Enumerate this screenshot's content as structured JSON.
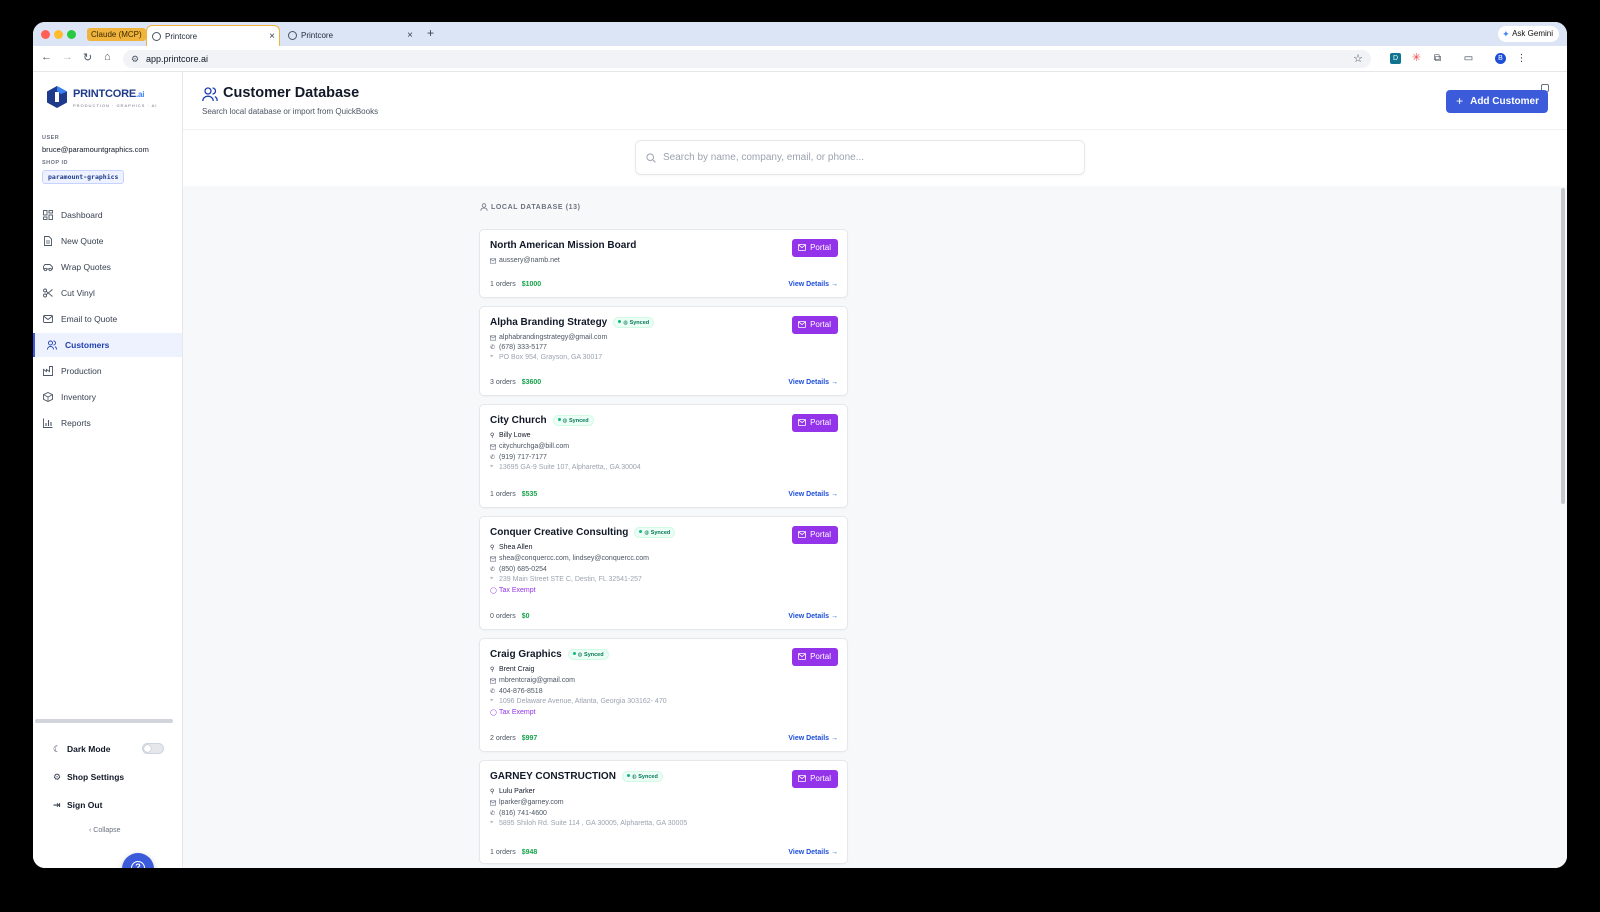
{
  "browser": {
    "group_chip": "Claude (MCP)",
    "tabs": [
      {
        "title": "Printcore",
        "active": true
      },
      {
        "title": "Printcore",
        "active": false
      }
    ],
    "url": "app.printcore.ai",
    "ask_gemini": "Ask Gemini",
    "profile_initial": "B"
  },
  "sidebar": {
    "logo_name": "PRINTCORE",
    "logo_suffix": ".ai",
    "logo_tagline": "PRODUCTION · GRAPHICS · AI",
    "user_label": "USER",
    "user_email": "bruce@paramountgraphics.com",
    "shop_label": "SHOP ID",
    "shop_id": "paramount-graphics",
    "nav": [
      {
        "label": "Dashboard",
        "icon": "grid-icon"
      },
      {
        "label": "New Quote",
        "icon": "document-icon"
      },
      {
        "label": "Wrap Quotes",
        "icon": "car-icon"
      },
      {
        "label": "Cut Vinyl",
        "icon": "scissors-icon"
      },
      {
        "label": "Email to Quote",
        "icon": "mail-icon"
      },
      {
        "label": "Customers",
        "icon": "users-icon",
        "active": true
      },
      {
        "label": "Production",
        "icon": "factory-icon"
      },
      {
        "label": "Inventory",
        "icon": "box-icon"
      },
      {
        "label": "Reports",
        "icon": "bar-chart-icon"
      }
    ],
    "dark_mode": "Dark Mode",
    "shop_settings": "Shop Settings",
    "sign_out": "Sign Out",
    "collapse": "Collapse"
  },
  "header": {
    "title": "Customer Database",
    "subtitle": "Search local database or import from QuickBooks",
    "add_button": "Add Customer"
  },
  "search": {
    "placeholder": "Search by name, company, email, or phone...",
    "value": ""
  },
  "section": {
    "label": "LOCAL DATABASE (13)"
  },
  "labels": {
    "portal": "Portal",
    "view_details": "View Details →",
    "synced": "Synced",
    "tax_exempt": "Tax Exempt",
    "orders_suffix": "orders"
  },
  "customers": [
    {
      "name": "North American Mission Board",
      "synced": false,
      "contact": "",
      "email": "aussery@namb.net",
      "phone": "",
      "address": "",
      "tax_exempt": false,
      "orders": 1,
      "total": "$1000"
    },
    {
      "name": "Alpha Branding Strategy",
      "synced": true,
      "contact": "",
      "email": "alphabrandingstrategy@gmail.com",
      "phone": "(678) 333-5177",
      "address": "PO Box 954, Grayson, GA 30017",
      "tax_exempt": false,
      "orders": 3,
      "total": "$3600"
    },
    {
      "name": "City Church",
      "synced": true,
      "contact": "Billy Lowe",
      "email": "citychurchga@bill.com",
      "phone": "(919) 717-7177",
      "address": "13695 GA-9 Suite 107, Alpharetta,, GA 30004",
      "tax_exempt": false,
      "orders": 1,
      "total": "$535"
    },
    {
      "name": "Conquer Creative Consulting",
      "synced": true,
      "contact": "Shea Allen",
      "email": "shea@conquercc.com, lindsey@conquercc.com",
      "phone": "(850) 685-0254",
      "address": "239 Main Street STE C, Destin, FL 32541-257",
      "tax_exempt": true,
      "orders": 0,
      "total": "$0"
    },
    {
      "name": "Craig Graphics",
      "synced": true,
      "contact": "Brent Craig",
      "email": "mbrentcraig@gmail.com",
      "phone": "404-876-8518",
      "address": "1096 Delaware Avenue, Atlanta, Georgia 303162- 470",
      "tax_exempt": true,
      "orders": 2,
      "total": "$997"
    },
    {
      "name": "GARNEY CONSTRUCTION",
      "synced": true,
      "contact": "Lulu Parker",
      "email": "lparker@garney.com",
      "phone": "(816) 741-4600",
      "address": "5895 Shiloh Rd. Suite 114 , GA 30005, Alpharetta, GA 30005",
      "tax_exempt": false,
      "orders": 1,
      "total": "$948"
    }
  ]
}
